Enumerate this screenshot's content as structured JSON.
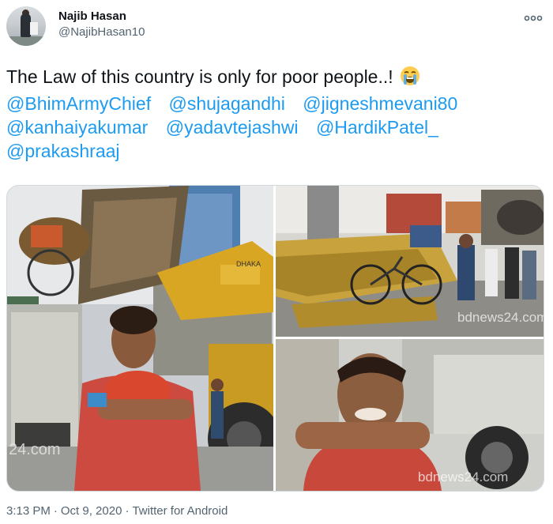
{
  "author": {
    "name": "Najib Hasan",
    "handle": "@NajibHasan10"
  },
  "tweet": {
    "text": "The Law of this country is only for poor people..!",
    "emoji": "loudly-crying-face",
    "mentions": [
      "@BhimArmyChief",
      "@shujagandhi",
      "@jigneshmevani80",
      "@kanhaiyakumar",
      "@yadavtejashwi",
      "@HardikPatel_",
      "@prakashraaj"
    ]
  },
  "media": {
    "watermark_tr": "bdnews24.com",
    "watermark_br": "bdnews24.com",
    "watermark_left": "24.com",
    "sign_text": "DHAKA"
  },
  "meta": {
    "time": "3:13 PM",
    "date": "Oct 9, 2020",
    "separator": "·",
    "source": "Twitter for Android"
  },
  "colors": {
    "link": "#1d9bf0",
    "text": "#0f1419",
    "muted": "#536471",
    "border": "#cfd9de"
  }
}
